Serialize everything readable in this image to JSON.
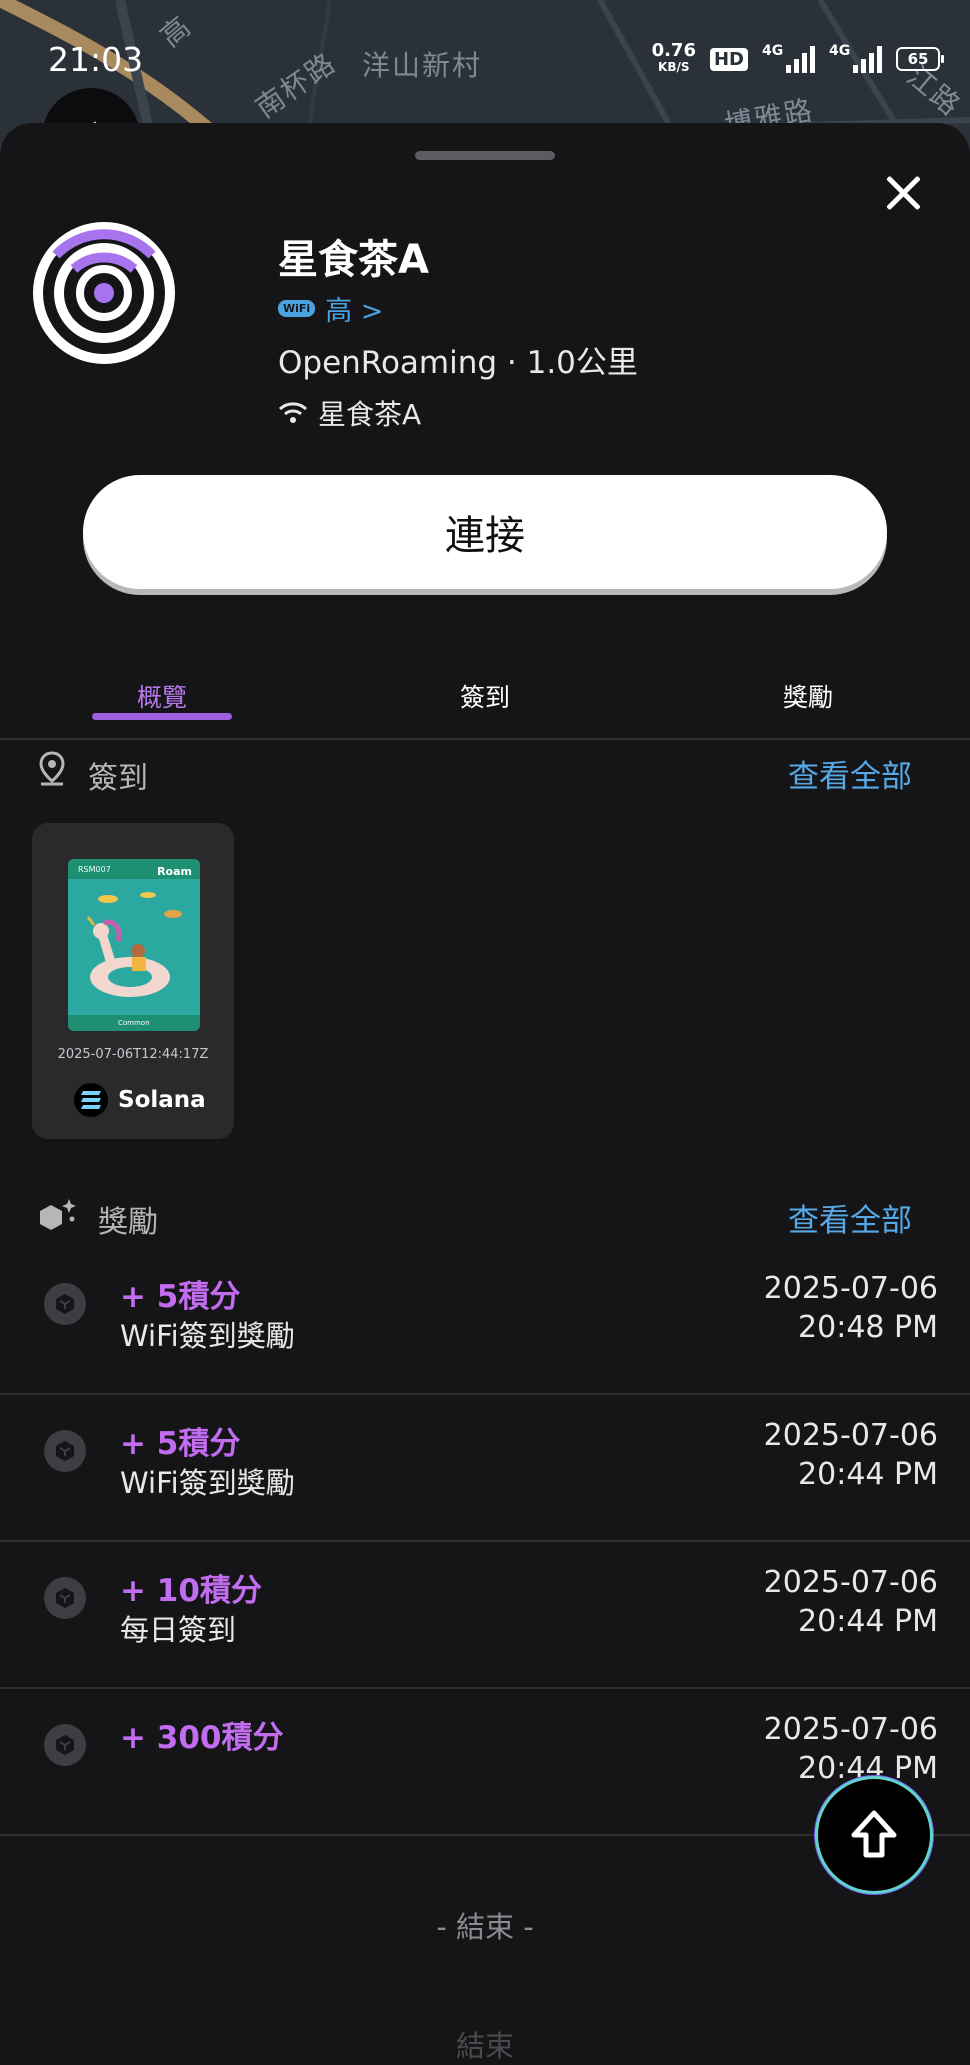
{
  "status_bar": {
    "time": "21:03",
    "net_speed_value": "0.76",
    "net_speed_unit": "KB/S",
    "hd_badge": "HD",
    "signal_1_label": "4G",
    "signal_2_label": "4G",
    "battery": "65"
  },
  "map": {
    "labels": [
      "洋山新村",
      "南杯路",
      "博雅路",
      "高",
      "江路"
    ]
  },
  "hotspot": {
    "name": "星食茶A",
    "signal_tag": "WiFi",
    "signal_strength": "高 >",
    "network_distance": "OpenRoaming · 1.0公里",
    "ssid": "星食茶A"
  },
  "connect_button": "連接",
  "tabs": [
    {
      "label": "概覽",
      "active": true
    },
    {
      "label": "簽到",
      "active": false
    },
    {
      "label": "獎勵",
      "active": false
    }
  ],
  "checkins_section": {
    "title": "簽到",
    "view_all": "查看全部",
    "cards": [
      {
        "image_tag": "RSM007",
        "image_brand": "Roam",
        "rarity": "Common",
        "timestamp": "2025-07-06T12:44:17Z",
        "chain": "Solana"
      }
    ]
  },
  "rewards_section": {
    "title": "獎勵",
    "view_all": "查看全部",
    "items": [
      {
        "points": "+ 5積分",
        "description": "WiFi簽到獎勵",
        "date": "2025-07-06",
        "time": "20:48 PM"
      },
      {
        "points": "+ 5積分",
        "description": "WiFi簽到獎勵",
        "date": "2025-07-06",
        "time": "20:44 PM"
      },
      {
        "points": "+ 10積分",
        "description": "每日簽到",
        "date": "2025-07-06",
        "time": "20:44 PM"
      },
      {
        "points": "+ 300積分",
        "description": "",
        "date": "2025-07-06",
        "time": "20:44 PM"
      }
    ]
  },
  "end_label": "- 結束 -",
  "end_label_partial": "結束",
  "colors": {
    "accent_purple": "#9f5ee0",
    "points_purple": "#c26cf0",
    "link_blue": "#56a8e6",
    "background": "#151517"
  },
  "icons": [
    "close-icon",
    "roam-wifi-logo",
    "wifi-icon",
    "location-pin-icon",
    "rewards-icon",
    "reward-cube-icon",
    "solana-logo",
    "arrow-up-icon"
  ]
}
